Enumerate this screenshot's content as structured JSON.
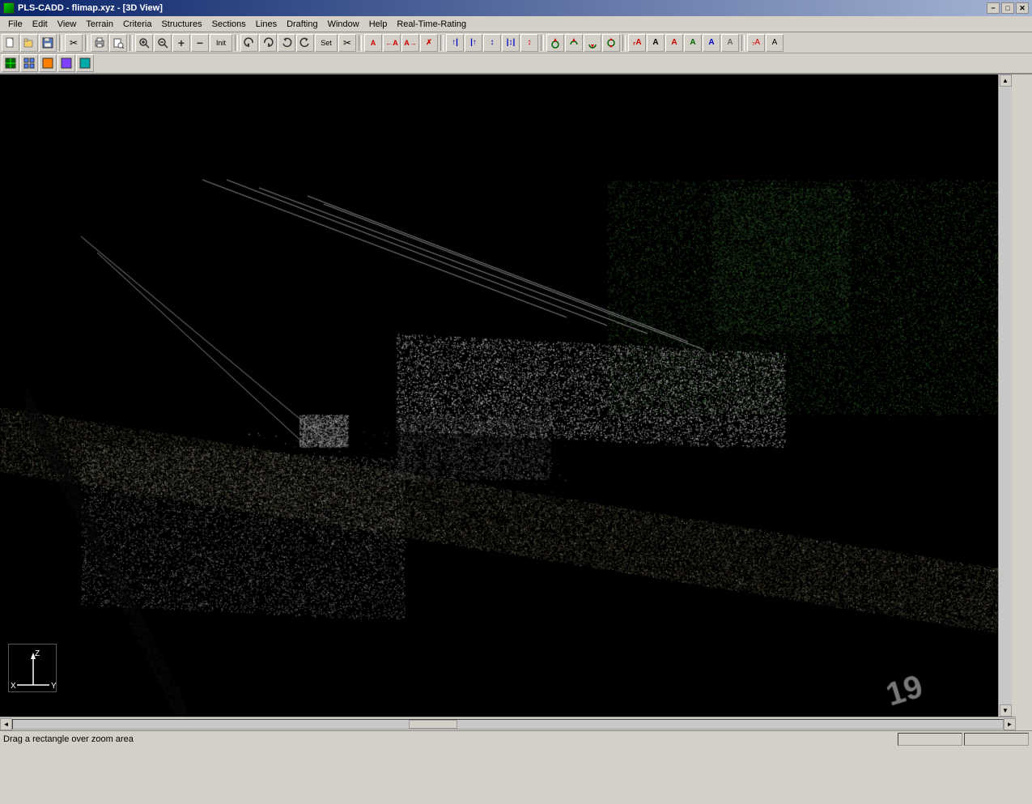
{
  "titleBar": {
    "title": "PLS-CADD - flimap.xyz - [3D View]",
    "appIcon": "pls-cadd-icon",
    "minBtn": "−",
    "maxBtn": "□",
    "closeBtn": "✕"
  },
  "menuBar": {
    "items": [
      {
        "id": "file",
        "label": "File"
      },
      {
        "id": "edit",
        "label": "Edit"
      },
      {
        "id": "view",
        "label": "View"
      },
      {
        "id": "terrain",
        "label": "Terrain"
      },
      {
        "id": "criteria",
        "label": "Criteria"
      },
      {
        "id": "structures",
        "label": "Structures"
      },
      {
        "id": "sections",
        "label": "Sections"
      },
      {
        "id": "lines",
        "label": "Lines"
      },
      {
        "id": "drafting",
        "label": "Drafting"
      },
      {
        "id": "window",
        "label": "Window"
      },
      {
        "id": "help",
        "label": "Help"
      },
      {
        "id": "realtime",
        "label": "Real-Time-Rating"
      }
    ]
  },
  "toolbar1": {
    "buttons": [
      {
        "id": "new",
        "icon": "📄",
        "label": "New"
      },
      {
        "id": "open",
        "icon": "📂",
        "label": "Open"
      },
      {
        "id": "save",
        "icon": "💾",
        "label": "Save"
      },
      {
        "id": "cut",
        "icon": "✂",
        "label": "Cut"
      },
      {
        "id": "print",
        "icon": "🖨",
        "label": "Print"
      },
      {
        "id": "printprev",
        "icon": "🔍",
        "label": "Print Preview"
      },
      {
        "id": "zoomin",
        "icon": "⊕",
        "label": "Zoom In"
      },
      {
        "id": "zoomout",
        "icon": "⊖",
        "label": "Zoom Out"
      },
      {
        "id": "zoomplus",
        "icon": "+",
        "label": "Zoom Plus"
      },
      {
        "id": "zoomminus",
        "icon": "−",
        "label": "Zoom Minus"
      },
      {
        "id": "zoominit",
        "icon": "Init",
        "label": "Zoom Init"
      },
      {
        "id": "rotleft",
        "icon": "↺",
        "label": "Rotate Left"
      },
      {
        "id": "rotright",
        "icon": "↻",
        "label": "Rotate Right"
      },
      {
        "id": "rotcw",
        "icon": "↻",
        "label": "Rotate CW"
      },
      {
        "id": "rotccw",
        "icon": "↺",
        "label": "Rotate CCW"
      },
      {
        "id": "set",
        "icon": "Set",
        "label": "Set"
      },
      {
        "id": "scissors",
        "icon": "✂",
        "label": "Cut"
      }
    ]
  },
  "statusBar": {
    "message": "Drag a rectangle over zoom area",
    "panels": [
      "",
      ""
    ]
  },
  "viewport": {
    "type": "3D View",
    "content": "point-cloud-lidar"
  },
  "axisIndicator": {
    "labels": [
      "Z",
      "X",
      "Y"
    ]
  }
}
